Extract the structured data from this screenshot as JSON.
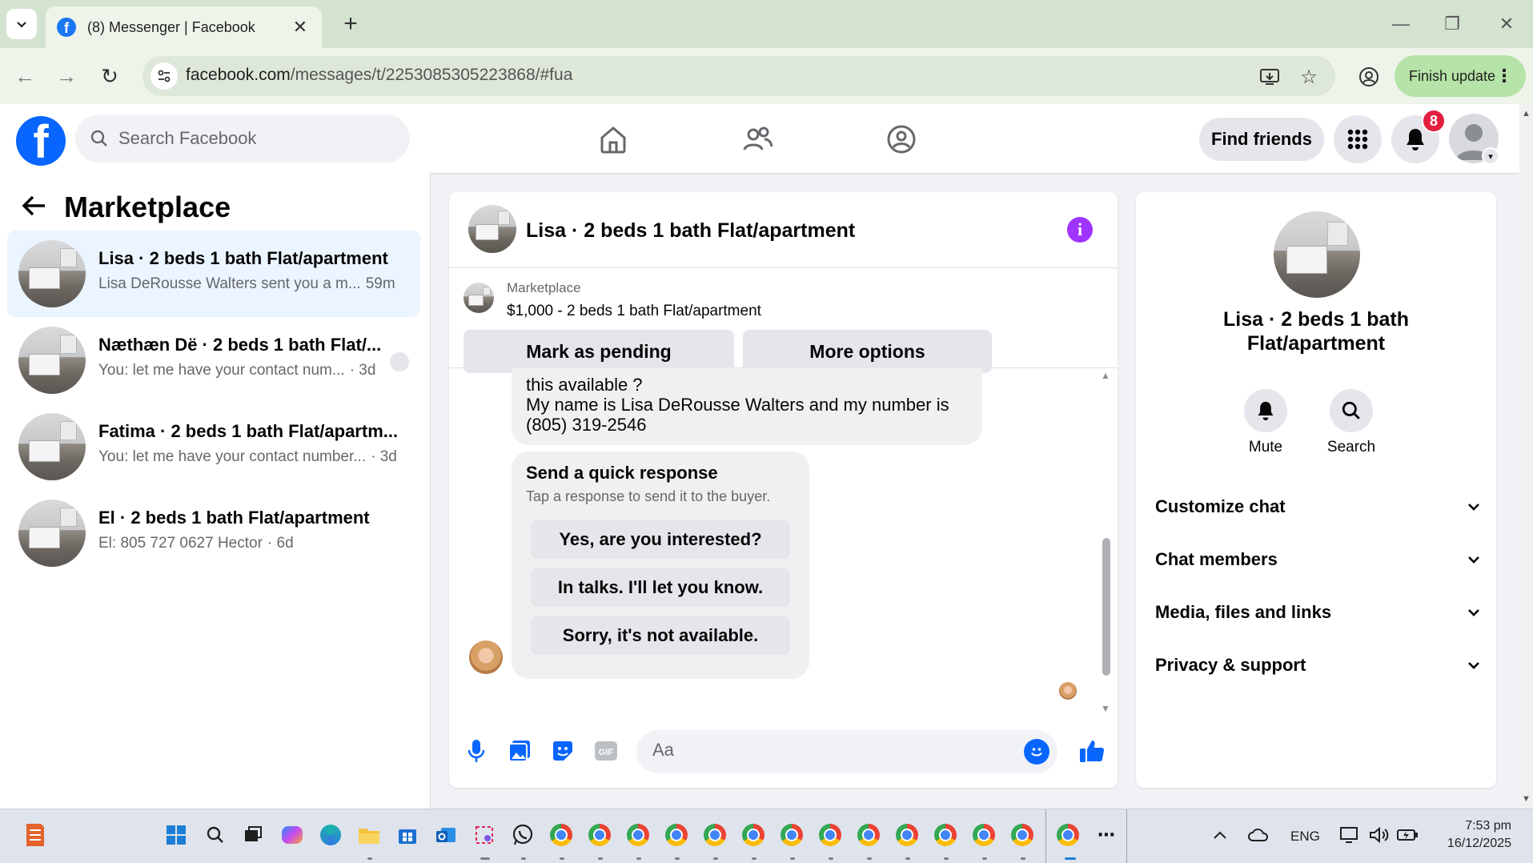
{
  "browser": {
    "tab_title": "(8) Messenger | Facebook",
    "url_domain": "facebook.com",
    "url_path": "/messages/t/2253085305223868/#fua",
    "finish_update": "Finish update"
  },
  "fb": {
    "search_placeholder": "Search Facebook",
    "find_friends": "Find friends",
    "notification_count": "8"
  },
  "left_panel": {
    "title": "Marketplace",
    "conversations": [
      {
        "title": "Lisa · 2 beds 1 bath Flat/apartment",
        "snippet": "Lisa DeRousse Walters sent you a m...",
        "time": "59m",
        "active": true
      },
      {
        "title": "Næthæn Dë · 2 beds 1 bath Flat/...",
        "snippet": "You: let me have your contact num...",
        "time": "· 3d",
        "active": false
      },
      {
        "title": "Fatima · 2 beds 1 bath Flat/apartm...",
        "snippet": "You: let me have your contact number...",
        "time": "· 3d",
        "active": false
      },
      {
        "title": "El · 2 beds 1 bath Flat/apartment",
        "snippet": "El: 805 727 0627 Hector",
        "time": "· 6d",
        "active": false
      }
    ]
  },
  "chat": {
    "title": "Lisa · 2 beds 1 bath Flat/apartment",
    "listing_label": "Marketplace",
    "listing_price": "$1,000 - 2 beds 1 bath Flat/apartment",
    "mark_pending": "Mark as pending",
    "more_options": "More options",
    "message_lines": [
      "this available ?",
      "My name is Lisa DeRousse Walters and my number is",
      "(805) 319-2546"
    ],
    "quick_title": "Send a quick response",
    "quick_sub": "Tap a response to send it to the buyer.",
    "quick_responses": [
      "Yes, are you interested?",
      "In talks. I'll let you know.",
      "Sorry, it's not available."
    ],
    "composer_placeholder": "Aa"
  },
  "right_panel": {
    "name": "Lisa · 2 beds 1 bath Flat/apartment",
    "mute": "Mute",
    "search": "Search",
    "sections": [
      "Customize chat",
      "Chat members",
      "Media, files and links",
      "Privacy & support"
    ]
  },
  "taskbar": {
    "language": "ENG",
    "time": "7:53 pm",
    "date": "16/12/2025"
  },
  "colors": {
    "fb_blue": "#0866ff",
    "info_purple": "#a033ff",
    "badge_red": "#e41e3f",
    "active_row": "#ebf5ff"
  }
}
